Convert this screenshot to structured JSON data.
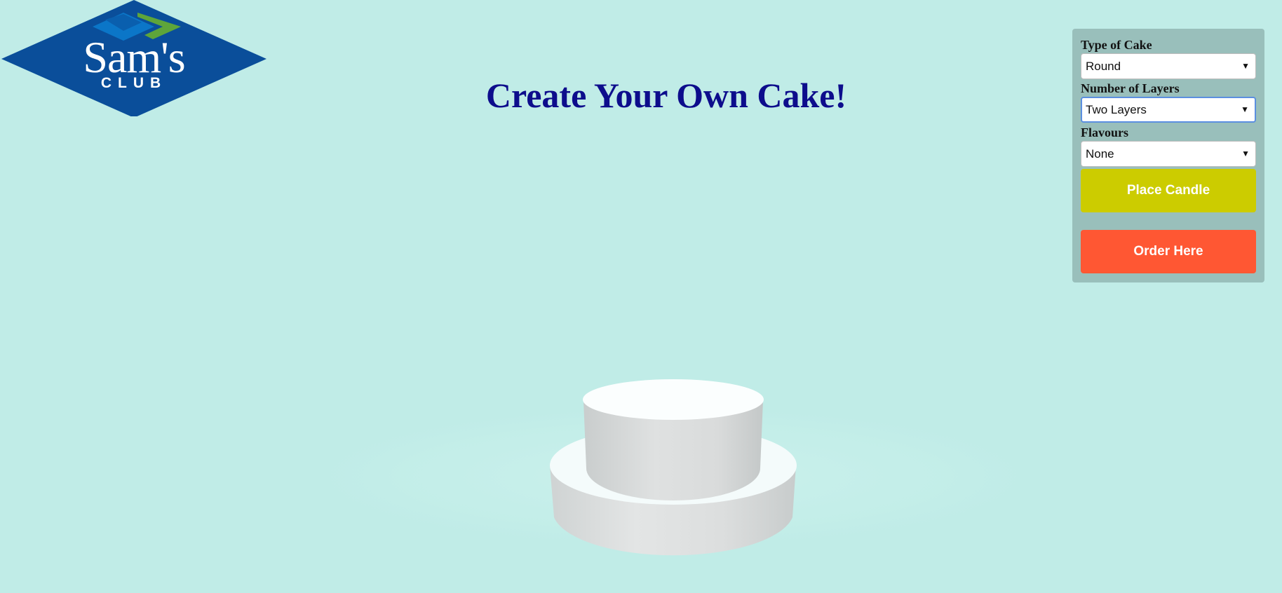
{
  "logo": {
    "brand": "Sam's",
    "sub": "CLUB"
  },
  "title": "Create Your Own Cake!",
  "panel": {
    "cake_type_label": "Type of Cake",
    "cake_type_value": "Round",
    "layers_label": "Number of Layers",
    "layers_value": "Two Layers",
    "flavours_label": "Flavours",
    "flavours_value": "None",
    "place_candle_label": "Place Candle",
    "order_label": "Order Here"
  },
  "colors": {
    "background": "#c0ece7",
    "title": "#0d0d8c",
    "panel": "#99bfbb",
    "place_candle": "#cccc00",
    "order": "#ff5733",
    "logo_blue": "#0a4e9a"
  },
  "icons": {
    "dropdown": "chevron-down-icon",
    "logo_mark": "diamond-logo-icon"
  }
}
